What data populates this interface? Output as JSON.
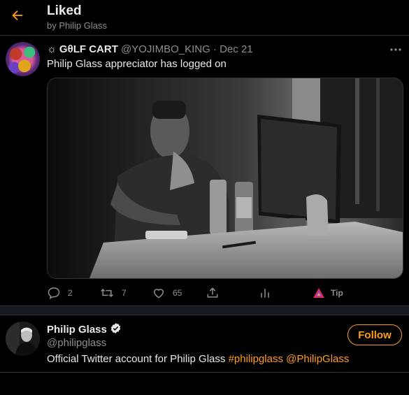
{
  "header": {
    "title": "Liked",
    "subtitle": "by Philip Glass",
    "back_icon": "arrow-left-icon"
  },
  "colors": {
    "accent": "#ff9f1a",
    "background": "#000000",
    "muted": "#8b8f93",
    "text": "#e7e9ea"
  },
  "tweet": {
    "name_symbol": "☼",
    "name": "GθLF CART",
    "handle": "@YOJIMBO_KING",
    "separator": "·",
    "date": "Dec 21",
    "text": "Philip Glass appreciator has logged on",
    "media_description_icon": "photo",
    "actions": {
      "reply_count": "2",
      "retweet_count": "7",
      "like_count": "65",
      "tip_label": "Tip"
    }
  },
  "user": {
    "name": "Philip Glass",
    "handle": "@philipglass",
    "bio_text": "Official Twitter account for Philip Glass ",
    "bio_hashtag": "#philipglass",
    "bio_space": " ",
    "bio_mention": "@PhilipGlass",
    "follow_label": "Follow",
    "verified": true
  }
}
